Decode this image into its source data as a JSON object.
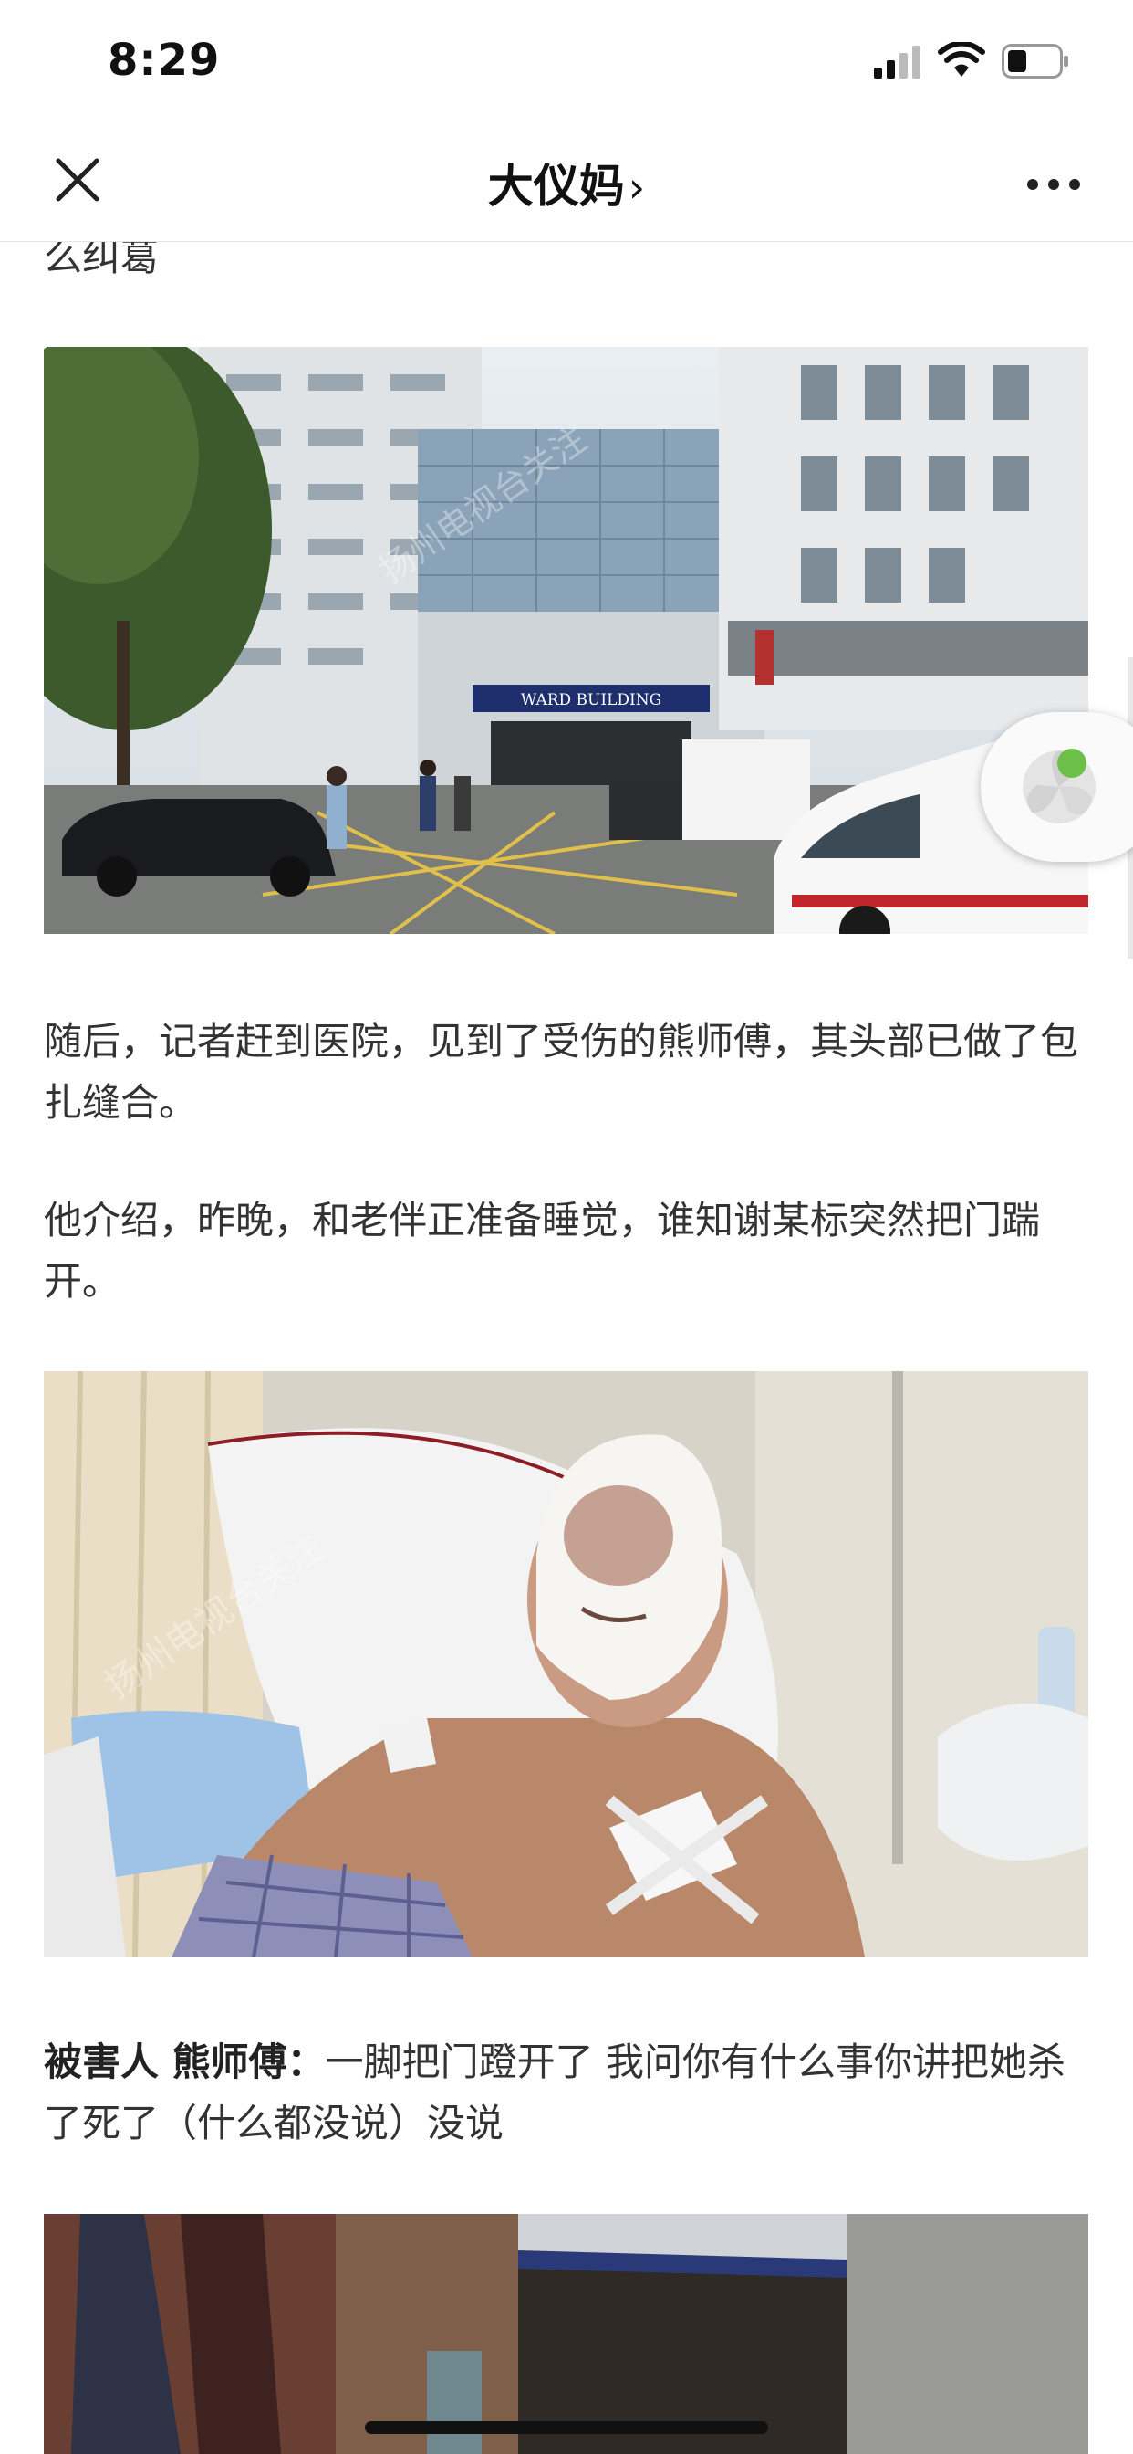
{
  "status": {
    "time": "8:29"
  },
  "nav": {
    "title": "大仪妈",
    "chevron": "›"
  },
  "article": {
    "p_top": "么纠葛",
    "p1": "随后，记者赶到医院，见到了受伤的熊师傅，其头部已做了包扎缝合。",
    "p2": "他介绍，昨晚，和老伴正准备睡觉，谁知谢某标突然把门踹开。",
    "p3_speaker": "被害人 熊师傅：",
    "p3_text": "一脚把门蹬开了 我问你有什么事你讲把她杀了死了（什么都没说）没说"
  },
  "images": {
    "hospital_sign": "WARD BUILDING",
    "hospital_watermark": "扬州电视台关注",
    "patient_watermark": "扬州电视台关注"
  },
  "icons": {
    "close": "close-icon",
    "more": "more-icon",
    "signal": "signal-icon",
    "wifi": "wifi-icon",
    "battery": "battery-icon",
    "float": "floating-player-icon"
  }
}
